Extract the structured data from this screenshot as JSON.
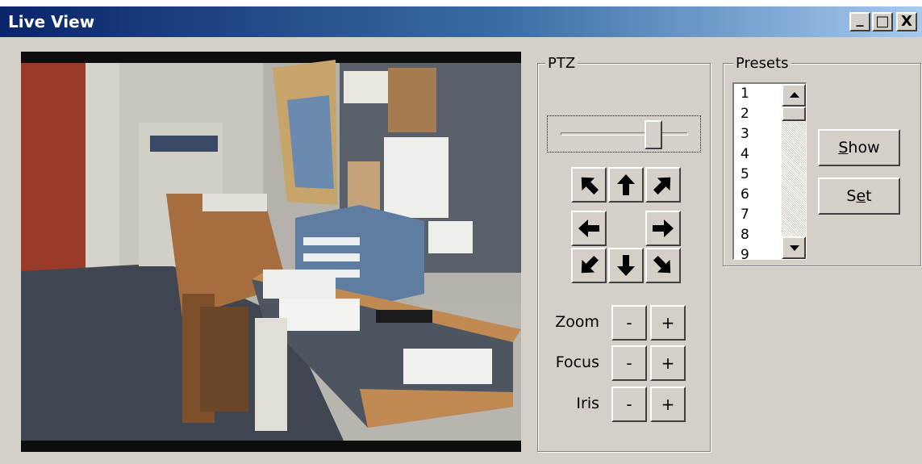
{
  "window": {
    "title": "Live View",
    "controls": {
      "minimize": "_",
      "maximize": "□",
      "close": "X"
    }
  },
  "ptz": {
    "group_label": "PTZ",
    "slider_value": 0.73,
    "arrows": [
      "up-left",
      "up",
      "up-right",
      "left",
      "right",
      "down-left",
      "down",
      "down-right"
    ],
    "rows": [
      {
        "label": "Zoom",
        "minus": "-",
        "plus": "+"
      },
      {
        "label": "Focus",
        "minus": "-",
        "plus": "+"
      },
      {
        "label": "Iris",
        "minus": "-",
        "plus": "+"
      }
    ]
  },
  "presets": {
    "group_label": "Presets",
    "items": [
      "1",
      "2",
      "3",
      "4",
      "5",
      "6",
      "7",
      "8",
      "9"
    ],
    "show_pre": "",
    "show_key": "S",
    "show_post": "how",
    "set_pre": "S",
    "set_key": "e",
    "set_post": "t"
  },
  "video": {
    "description_icon": "camera-feed"
  }
}
